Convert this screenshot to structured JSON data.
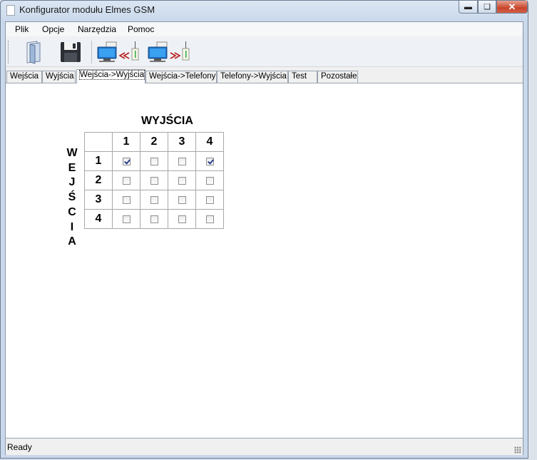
{
  "window": {
    "title": "Konfigurator modułu Elmes GSM"
  },
  "menu": [
    "Plik",
    "Opcje",
    "Narzędzia",
    "Pomoc"
  ],
  "toolbar": {
    "buttons": [
      "open-icon",
      "save-icon",
      "read-from-device-icon",
      "write-to-device-icon"
    ]
  },
  "tabs": [
    "Wejścia",
    "Wyjścia",
    "Wejścia->Wyjścia",
    "Wejścia->Telefony",
    "Telefony->Wyjścia",
    "Test",
    "Pozostałe"
  ],
  "active_tab": "Wejścia->Wyjścia",
  "matrix": {
    "outputs_title": "WYJŚCIA",
    "inputs_title_letters": [
      "W",
      "E",
      "J",
      "Ś",
      "C",
      "I",
      "A"
    ],
    "columns": [
      "1",
      "2",
      "3",
      "4"
    ],
    "rows": [
      "1",
      "2",
      "3",
      "4"
    ],
    "checked": [
      [
        true,
        false,
        false,
        true
      ],
      [
        false,
        false,
        false,
        false
      ],
      [
        false,
        false,
        false,
        false
      ],
      [
        false,
        false,
        false,
        false
      ]
    ]
  },
  "status": {
    "text": "Ready"
  },
  "colors": {
    "accent": "#2a3f8c",
    "close_button": "#c8452b"
  }
}
